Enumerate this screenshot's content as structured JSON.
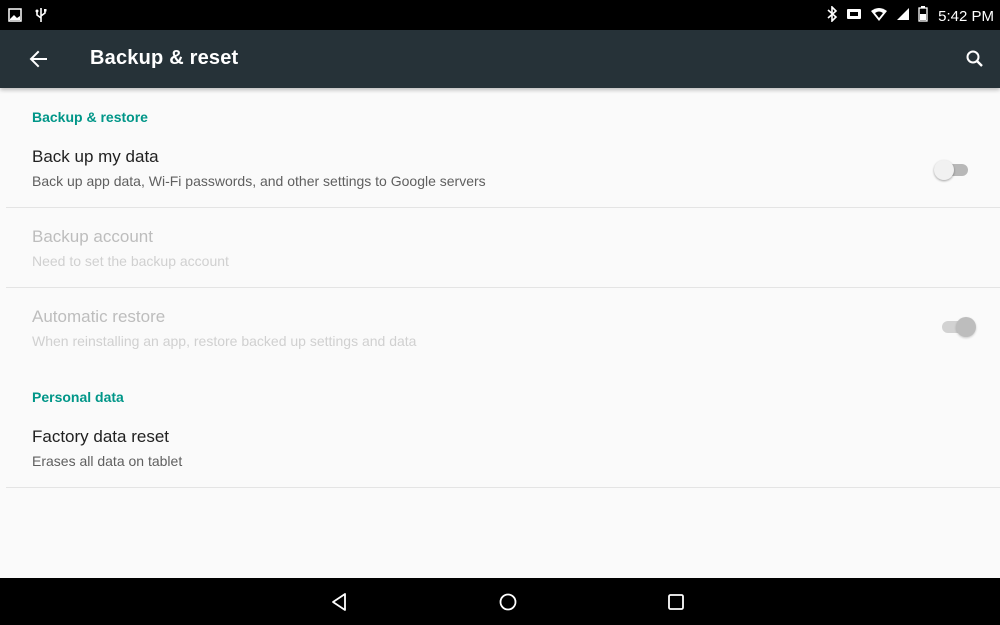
{
  "status_bar": {
    "left_icons": [
      "image-icon",
      "usb-icon"
    ],
    "right_icons": [
      "bluetooth-icon",
      "sd-card-icon",
      "wifi-icon",
      "signal-icon",
      "battery-icon"
    ],
    "time": "5:42 PM"
  },
  "app_bar": {
    "title": "Backup & reset",
    "background": "#263238"
  },
  "sections": {
    "backup_restore_header": "Backup & restore",
    "personal_data_header": "Personal data"
  },
  "items": {
    "backup_data": {
      "title": "Back up my data",
      "subtitle": "Back up app data, Wi-Fi passwords, and other settings to Google servers",
      "switch_on": false
    },
    "backup_account": {
      "title": "Backup account",
      "subtitle": "Need to set the backup account",
      "enabled": false
    },
    "auto_restore": {
      "title": "Automatic restore",
      "subtitle": "When reinstalling an app, restore backed up settings and data",
      "switch_on": true,
      "enabled": false
    },
    "factory_reset": {
      "title": "Factory data reset",
      "subtitle": "Erases all data on tablet"
    }
  },
  "colors": {
    "accent": "#009688",
    "status_bar": "#000000",
    "nav_bar": "#000000"
  }
}
